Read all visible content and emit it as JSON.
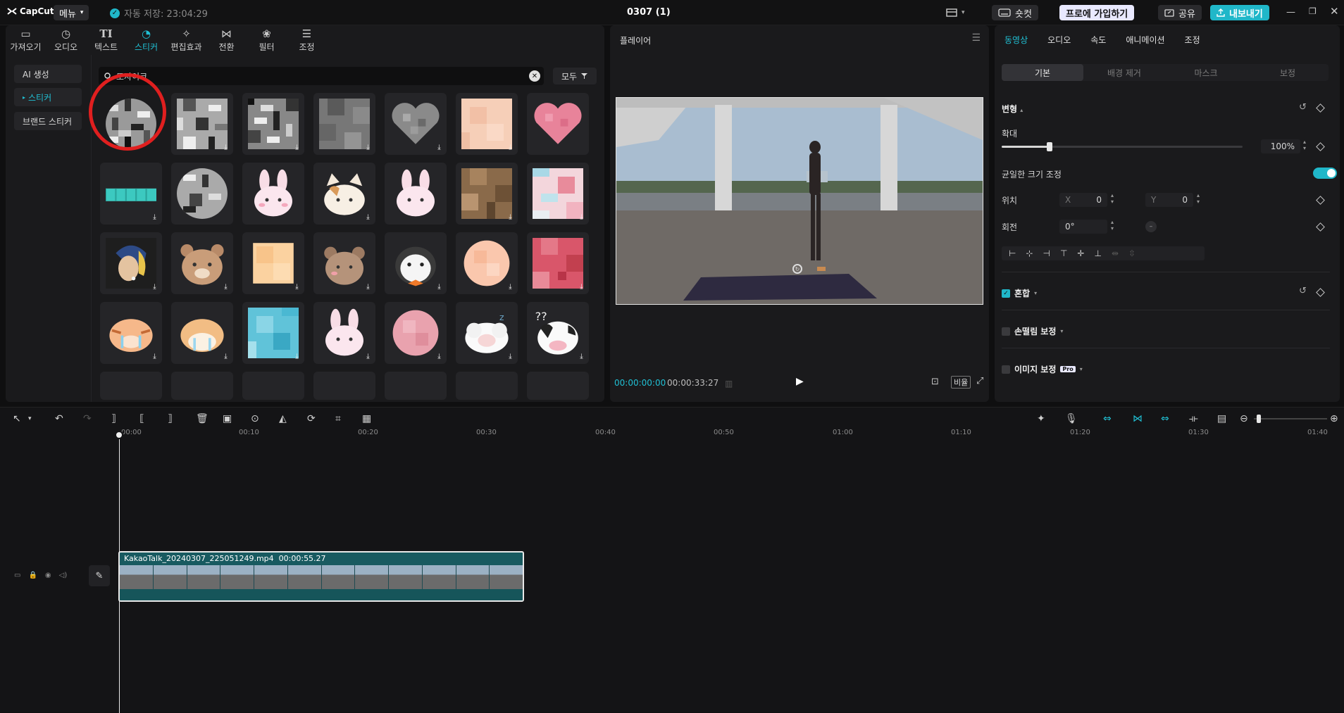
{
  "titlebar": {
    "logo": "CapCut",
    "menu_label": "메뉴",
    "autosave": "자동 저장: 23:04:29",
    "project_title": "0307 (1)",
    "shortcut_label": "숏컷",
    "pro_join_label": "프로에 가입하기",
    "share_label": "공유",
    "export_label": "내보내기"
  },
  "toolbar": {
    "tabs": [
      {
        "label": "가져오기",
        "icon": "import-icon"
      },
      {
        "label": "오디오",
        "icon": "audio-icon"
      },
      {
        "label": "텍스트",
        "icon": "text-icon"
      },
      {
        "label": "스티커",
        "icon": "sticker-icon"
      },
      {
        "label": "편집효과",
        "icon": "effects-icon"
      },
      {
        "label": "전환",
        "icon": "transition-icon"
      },
      {
        "label": "필터",
        "icon": "filter-icon"
      },
      {
        "label": "조정",
        "icon": "adjust-icon"
      }
    ],
    "active_index": 3
  },
  "sidebar": {
    "items": [
      "AI 생성",
      "스티커",
      "브랜드 스티커"
    ],
    "active_index": 1
  },
  "search": {
    "value": "모자이크",
    "filter_label": "모두"
  },
  "player": {
    "title": "플레이어",
    "current_time": "00:00:00:00",
    "total_time": "00:00:33:27",
    "ratio_label": "비율"
  },
  "inspector": {
    "tabs": [
      "동영상",
      "오디오",
      "속도",
      "애니메이션",
      "조정"
    ],
    "active_tab": 0,
    "subtabs": [
      "기본",
      "배경 제거",
      "마스크",
      "보정"
    ],
    "active_subtab": 0,
    "transform_label": "변형",
    "scale_label": "확대",
    "scale_value": "100%",
    "scale_level": 0.2,
    "uniform_scale_label": "균일한 크기 조정",
    "uniform_scale_on": true,
    "position_label": "위치",
    "pos_x_label": "X",
    "pos_x_value": "0",
    "pos_y_label": "Y",
    "pos_y_value": "0",
    "rotation_label": "회전",
    "rotation_value": "0°",
    "blend_label": "혼합",
    "blend_checked": true,
    "stabilize_label": "손떨림 보정",
    "image_adjust_label": "이미지 보정",
    "pro_badge": "Pro"
  },
  "timeline": {
    "ruler_labels": [
      "00:00",
      "00:10",
      "00:20",
      "00:30",
      "00:40",
      "00:50",
      "01:00",
      "01:10",
      "01:20",
      "01:30",
      "01:40"
    ],
    "clip_name": "KakaoTalk_20240307_225051249.mp4",
    "clip_duration": "00:00:55.27"
  },
  "colors": {
    "accent": "#20c0d4",
    "highlight_circle": "#e01f1f",
    "clip_bg": "#185a60"
  }
}
